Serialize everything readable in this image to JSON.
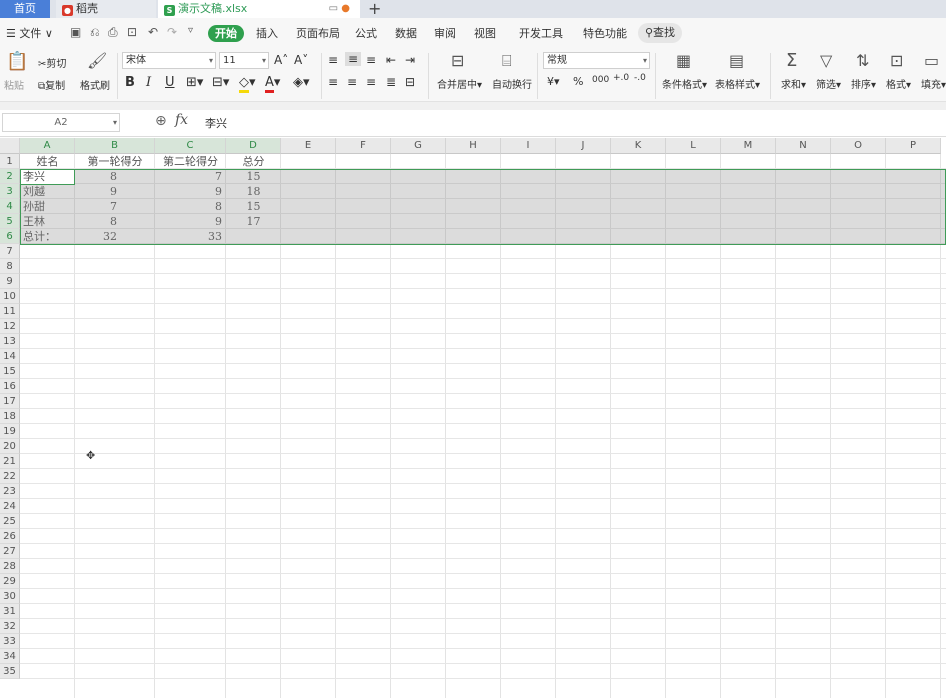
{
  "tabs": [
    {
      "label": "首页"
    },
    {
      "label": "稻壳"
    },
    {
      "label": "演示文稿.xlsx"
    }
  ],
  "menu": {
    "file": "文件",
    "start": "开始",
    "items": [
      "插入",
      "页面布局",
      "公式",
      "数据",
      "审阅",
      "视图",
      "开发工具",
      "特色功能"
    ],
    "search": "查找"
  },
  "ribbon": {
    "paste": "粘贴",
    "cut": "剪切",
    "copy": "复制",
    "format_painter": "格式刷",
    "font_name": "宋体",
    "font_size": "11",
    "merge_center": "合并居中",
    "wrap_text": "自动换行",
    "number_format": "常规",
    "conditional_format": "条件格式",
    "table_style": "表格样式",
    "sum": "求和",
    "filter": "筛选",
    "sort": "排序",
    "format": "格式",
    "fill": "填充"
  },
  "formula_bar": {
    "cell_ref": "A2",
    "fx": "fx",
    "content": "李兴"
  },
  "columns": [
    "A",
    "B",
    "C",
    "D",
    "E",
    "F",
    "G",
    "H",
    "I",
    "J",
    "K",
    "L",
    "M",
    "N",
    "O",
    "P"
  ],
  "rows": [
    "1",
    "2",
    "3",
    "4",
    "5",
    "6",
    "7",
    "8",
    "9",
    "10",
    "11",
    "12",
    "13",
    "14",
    "15",
    "16",
    "17",
    "18",
    "19",
    "20",
    "21",
    "22",
    "23",
    "24",
    "25",
    "26",
    "27",
    "28",
    "29",
    "30",
    "31",
    "32",
    "33",
    "34",
    "35"
  ],
  "sheet": {
    "header": [
      "姓名",
      "第一轮得分",
      "第二轮得分",
      "总分"
    ],
    "data": [
      [
        "李兴",
        "8",
        "7",
        "15"
      ],
      [
        "刘越",
        "9",
        "9",
        "18"
      ],
      [
        "孙甜",
        "7",
        "8",
        "15"
      ],
      [
        "王林",
        "8",
        "9",
        "17"
      ],
      [
        "总计：",
        "32",
        "33",
        ""
      ]
    ]
  },
  "colors": {
    "accent": "#2fa04e",
    "home_tab": "#4a7fd8",
    "selection_border": "#3f9b57"
  }
}
